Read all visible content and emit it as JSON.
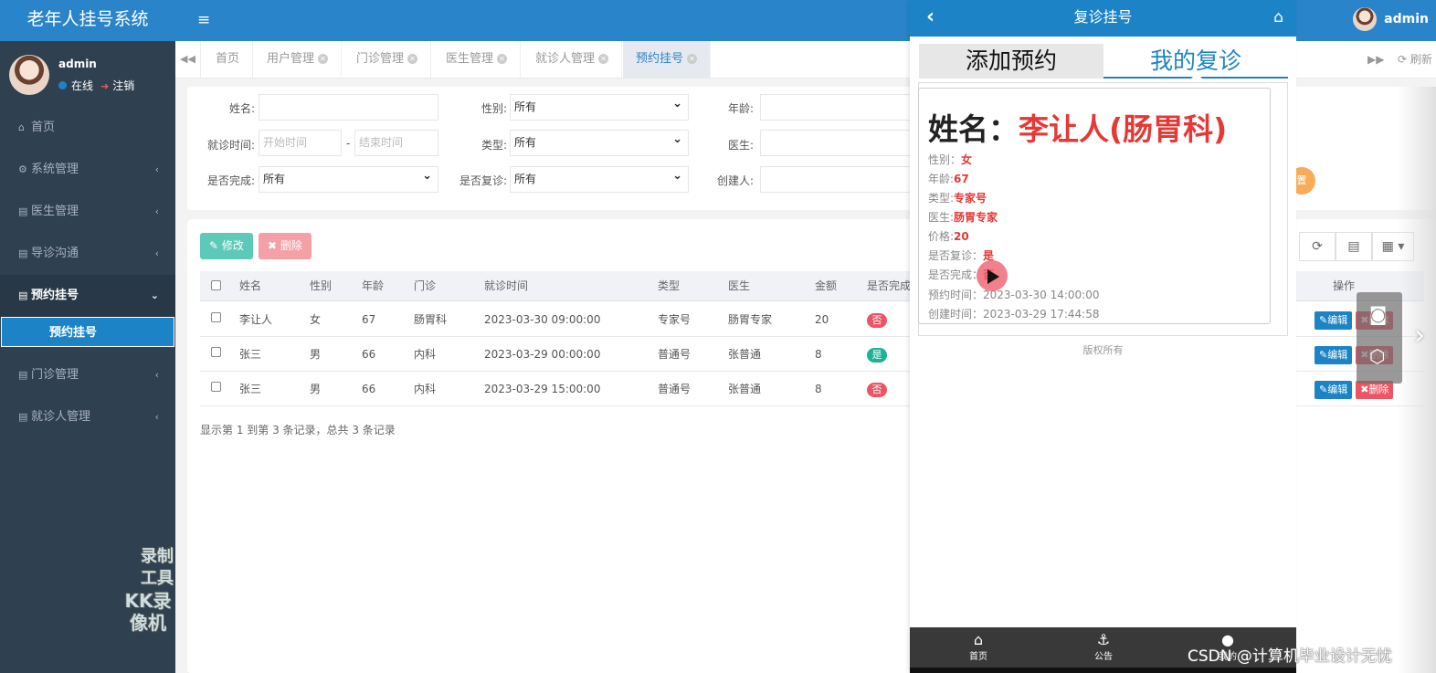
{
  "app": {
    "title": "老年人挂号系统",
    "user": "admin",
    "status": "在线",
    "logout": "注销"
  },
  "sidebar": {
    "items": [
      {
        "label": "首页",
        "icon": "home-icon"
      },
      {
        "label": "系统管理",
        "icon": "gear-icon"
      },
      {
        "label": "医生管理",
        "icon": "book-icon"
      },
      {
        "label": "导诊沟通",
        "icon": "book-icon"
      },
      {
        "label": "预约挂号",
        "icon": "book-icon"
      },
      {
        "label": "门诊管理",
        "icon": "book-icon"
      },
      {
        "label": "就诊人管理",
        "icon": "book-icon"
      }
    ],
    "active_sub": "预约挂号"
  },
  "watermark": {
    "line1": "录制工具",
    "line2": "KK录像机"
  },
  "tabs": [
    "首页",
    "用户管理",
    "门诊管理",
    "医生管理",
    "就诊人管理",
    "预约挂号"
  ],
  "tab_refresh": "刷新",
  "filters": {
    "name": "姓名:",
    "gender": "性别:",
    "gender_value": "所有",
    "age": "年龄:",
    "visit_time": "就诊时间:",
    "start_ph": "开始时间",
    "end_ph": "结束时间",
    "type": "类型:",
    "type_value": "所有",
    "doctor": "医生:",
    "completed": "是否完成:",
    "completed_value": "所有",
    "revisit": "是否复诊:",
    "revisit_value": "所有",
    "creator": "创建人:",
    "reset_btn": "置"
  },
  "toolbar": {
    "edit": "修改",
    "delete": "删除"
  },
  "table": {
    "headers": [
      "姓名",
      "性别",
      "年龄",
      "门诊",
      "就诊时间",
      "类型",
      "医生",
      "金额",
      "是否完成",
      "操作"
    ],
    "rows": [
      {
        "name": "李让人",
        "gender": "女",
        "age": "67",
        "clinic": "肠胃科",
        "time": "2023-03-30 09:00:00",
        "type": "专家号",
        "doctor": "肠胃专家",
        "amount": "20",
        "done": "否"
      },
      {
        "name": "张三",
        "gender": "男",
        "age": "66",
        "clinic": "内科",
        "time": "2023-03-29 00:00:00",
        "type": "普通号",
        "doctor": "张普通",
        "amount": "8",
        "done": "是"
      },
      {
        "name": "张三",
        "gender": "男",
        "age": "66",
        "clinic": "内科",
        "time": "2023-03-29 15:00:00",
        "type": "普通号",
        "doctor": "张普通",
        "amount": "8",
        "done": "否"
      }
    ],
    "edit": "编辑",
    "delete": "删除",
    "footer": "显示第 1 到第 3 条记录，总共 3 条记录"
  },
  "mobile": {
    "title": "复诊挂号",
    "tab_add": "添加预约",
    "tab_mine": "我的复诊",
    "card": {
      "name_label": "姓名：",
      "name_value": "李让人(肠胃科)",
      "gender_label": "性别：",
      "gender_value": "女",
      "age_label": "年龄:",
      "age_value": "67",
      "type_label": "类型:",
      "type_value": "专家号",
      "doctor_label": "医生:",
      "doctor_value": "肠胃专家",
      "price_label": "价格:",
      "price_value": "20",
      "revisit_label": "是否复诊：",
      "revisit_value": "是",
      "done_label": "是否完成：",
      "done_value": "否",
      "appt_label": "预约时间：",
      "appt_value": "2023-03-30 14:00:00",
      "created_label": "创建时间：",
      "created_value": "2023-03-29 17:44:58"
    },
    "copyright": "版权所有",
    "footer": [
      {
        "label": "首页",
        "icon": "home-icon"
      },
      {
        "label": "公告",
        "icon": "anchor-icon"
      },
      {
        "label": "我的",
        "icon": "user-icon"
      }
    ]
  },
  "csdn_mark": "CSDN @计算机毕业设计无忧"
}
